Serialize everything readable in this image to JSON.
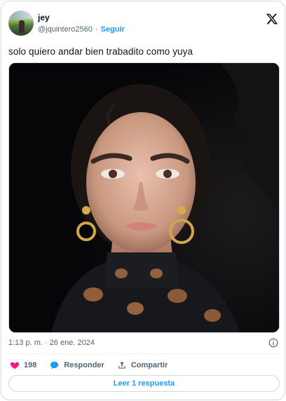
{
  "user": {
    "name": "jey",
    "handle": "@jquintero2560",
    "separator": "·",
    "follow_label": "Seguir"
  },
  "tweet": {
    "text": "solo quiero andar bien trabadito como yuya",
    "timestamp": "1:13 p. m. · 26 ene. 2024"
  },
  "actions": {
    "likes": "198",
    "reply_label": "Responder",
    "share_label": "Compartir"
  },
  "read_replies_label": "Leer 1 respuesta",
  "colors": {
    "accent": "#1d9bf0",
    "like": "#f91880",
    "text": "#0f1419",
    "muted": "#536471",
    "border": "#cfd9de"
  },
  "icons": [
    "x-logo-icon",
    "info-icon",
    "heart-icon",
    "reply-bubble-icon",
    "share-icon"
  ]
}
